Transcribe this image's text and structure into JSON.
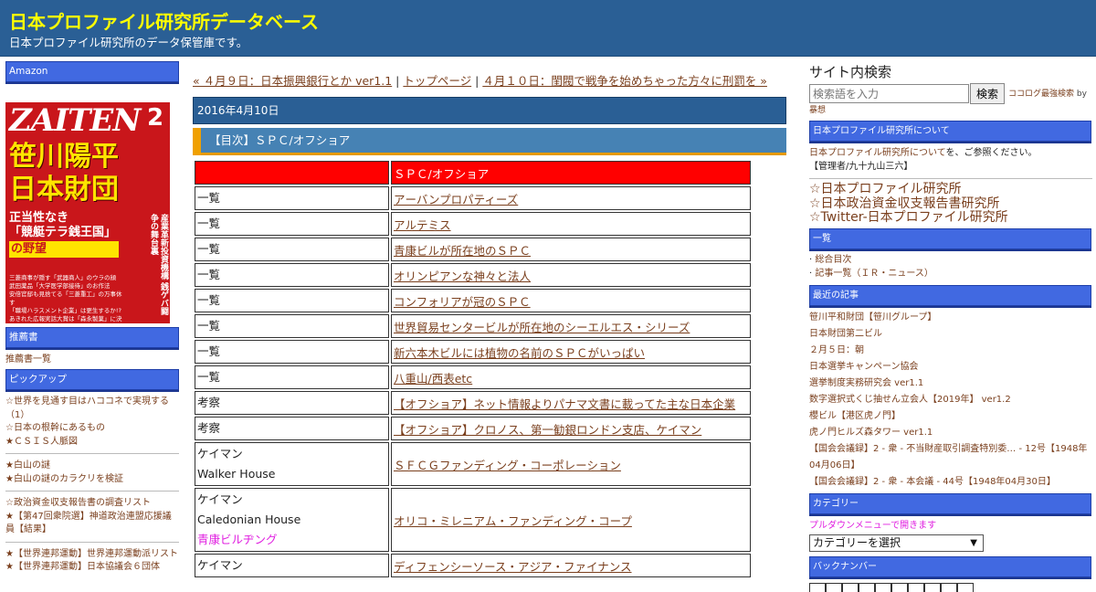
{
  "header": {
    "title": "日本プロファイル研究所データベース",
    "description": "日本プロファイル研究所のデータ保管庫です。"
  },
  "left": {
    "amazon_title": "Amazon",
    "cover": {
      "logo": "ZAITEN",
      "month": "2",
      "headline_1": "笹川陽平",
      "headline_2": "日本財団",
      "sub_1": "正当性なき",
      "sub_2": "「競艇テラ銭王国」",
      "sub_3": "の野望",
      "vertical": "産業革新投資機構 銭ゲバ闘争の舞台裏",
      "bottom": [
        "三菱商事が隠す「武器商人」のウラの顔",
        "武田薬品「大学医学部接待」のお作法",
        "安倍官邸も見捨てる「三菱重工」の万事休す",
        "「職場ハラスメント企業」は更生するか!?",
        "あきれた広報実話大賞は「森永製菓」に決定!"
      ]
    },
    "recommended_title": "推薦書",
    "recommended_link": "推薦書一覧",
    "pickup_title": "ピックアップ",
    "pickup_groups": [
      [
        "☆世界を見通す目はハココネで実現する（1）",
        "☆日本の根幹にあるもの",
        "★ＣＳＩＳ人脈図"
      ],
      [
        "★白山の謎",
        "★白山の謎のカラクリを検証"
      ],
      [
        "☆政治資金収支報告書の調査リスト",
        "★【第47回衆院選】神道政治連盟応援議員【結果】"
      ],
      [
        "★【世界連邦運動】世界連邦運動派リスト",
        "★【世界連邦運動】日本協議会６団体"
      ]
    ]
  },
  "main": {
    "nav_prev": "« ４月９日：日本振興銀行とか ver1.1",
    "nav_sep1": " | ",
    "nav_top": "トップページ",
    "nav_sep2": " | ",
    "nav_next": "４月１０日：閨閥で戦争を始めちゃった方々に刑罰を »",
    "date": "2016年4月10日",
    "post_title": "【目次】ＳＰＣ/オフショア",
    "table_header": [
      "",
      "ＳＰＣ/オフショア"
    ],
    "rows": [
      {
        "c1": [
          "一覧"
        ],
        "c2": "アーバンプロパティーズ"
      },
      {
        "c1": [
          "一覧"
        ],
        "c2": "アルテミス"
      },
      {
        "c1": [
          "一覧"
        ],
        "c2": "青康ビルが所在地のＳＰＣ"
      },
      {
        "c1": [
          "一覧"
        ],
        "c2": "オリンピアンな神々と法人"
      },
      {
        "c1": [
          "一覧"
        ],
        "c2": "コンフォリアが冠のＳＰＣ"
      },
      {
        "c1": [
          "一覧"
        ],
        "c2": "世界貿易センタービルが所在地のシーエルエス・シリーズ"
      },
      {
        "c1": [
          "一覧"
        ],
        "c2": "新六本木ビルには植物の名前のＳＰＣがいっぱい"
      },
      {
        "c1": [
          "一覧"
        ],
        "c2": "八重山/西表etc"
      },
      {
        "c1": [
          "考察"
        ],
        "c2": "【オフショア】ネット情報よりパナマ文書に載ってた主な日本企業"
      },
      {
        "c1": [
          "考察"
        ],
        "c2": "【オフショア】クロノス、第一勧銀ロンドン支店、ケイマン"
      },
      {
        "c1": [
          "ケイマン",
          "Walker House"
        ],
        "c2": "ＳＦＣＧファンディング・コーポレーション"
      },
      {
        "c1": [
          "ケイマン",
          "Caledonian House",
          "青康ビルヂング"
        ],
        "c2": "オリコ・ミレニアム・ファンディング・コープ"
      },
      {
        "c1": [
          "ケイマン"
        ],
        "c2": "ディフェンシーソース・アジア・ファイナンス"
      }
    ]
  },
  "right": {
    "search_title": "サイト内検索",
    "search_placeholder": "検索語を入力",
    "search_button": "検索",
    "search_credit": "ココログ最強検索",
    "search_credit_by": " by",
    "search_credit_2": "暴想",
    "about_title": "日本プロファイル研究所について",
    "about_link": "日本プロファイル研究所について",
    "about_text": "を、ご参照ください。",
    "about_admin": "【管理者/九十九山三六】",
    "big_links": [
      "☆日本プロファイル研究所",
      "☆日本政治資金収支報告書研究所",
      "☆Twitter-日本プロファイル研究所"
    ],
    "list_title": "一覧",
    "list_items": [
      "総合目次",
      "記事一覧（ＩＲ・ニュース）"
    ],
    "recent_title": "最近の記事",
    "recent_items": [
      "笹川平和財団【笹川グループ】",
      "日本財団第二ビル",
      "２月５日：朝",
      "日本選挙キャンペーン協会",
      "選挙制度実務研究会 ver1.1",
      "数字選択式くじ抽せん立会人【2019年】 ver1.2",
      "櫻ビル【港区虎ノ門】",
      "虎ノ門ヒルズ森タワー ver1.1",
      "【国会会議録】2 - 衆 - 不当財産取引調査特別委… - 12号【1948年04月06日】",
      "【国会会議録】2 - 衆 - 本会議 - 44号【1948年04月30日】"
    ],
    "category_title": "カテゴリー",
    "category_note": "プルダウンメニューで開きます",
    "category_select": "カテゴリーを選択",
    "backnumber_title": "バックナンバー"
  }
}
